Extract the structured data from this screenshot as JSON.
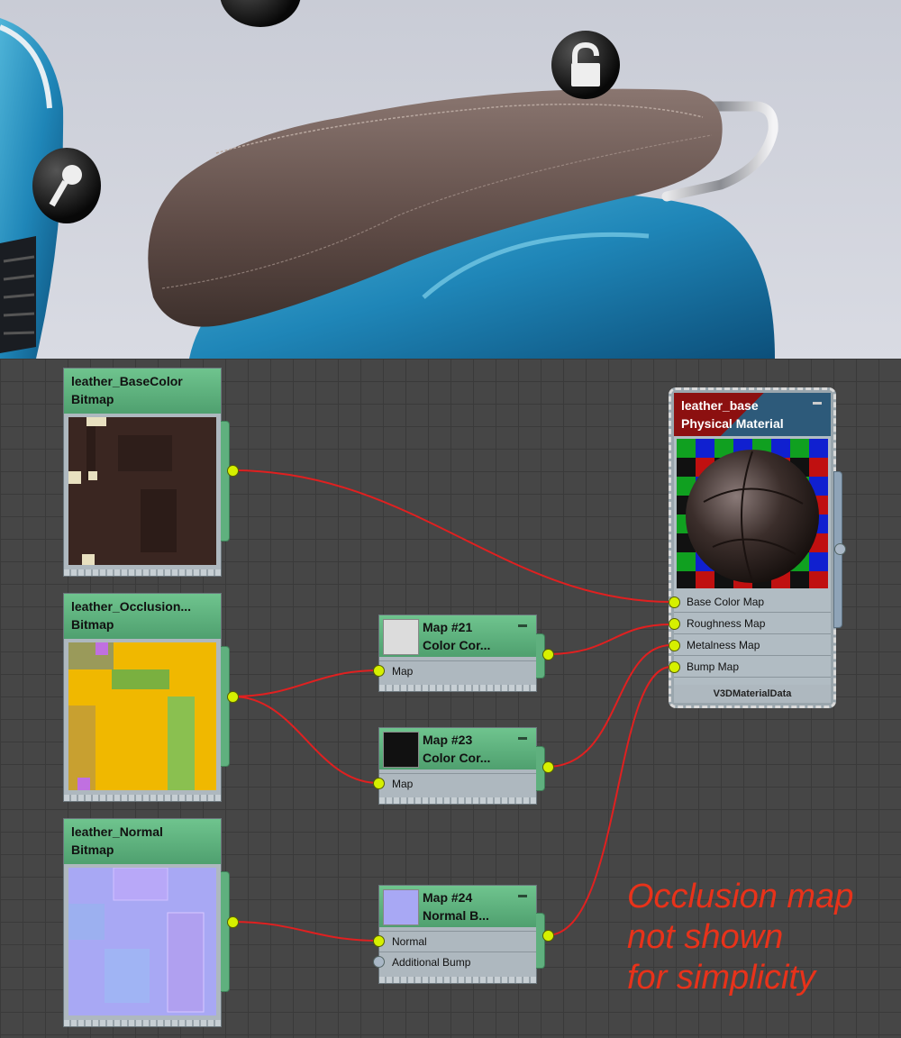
{
  "nodes": {
    "base_color": {
      "title": "leather_BaseColor",
      "type": "Bitmap"
    },
    "occlusion": {
      "title": "leather_Occlusion...",
      "type": "Bitmap"
    },
    "normal": {
      "title": "leather_Normal",
      "type": "Bitmap"
    },
    "map21": {
      "title": "Map #21",
      "subtitle": "Color Cor...",
      "socket": "Map"
    },
    "map23": {
      "title": "Map #23",
      "subtitle": "Color Cor...",
      "socket": "Map"
    },
    "map24": {
      "title": "Map #24",
      "subtitle": "Normal B...",
      "sockets": [
        "Normal",
        "Additional Bump"
      ]
    }
  },
  "material": {
    "name": "leather_base",
    "type": "Physical Material",
    "inputs": [
      "Base Color Map",
      "Roughness Map",
      "Metalness Map",
      "Bump Map"
    ],
    "footer": "V3DMaterialData"
  },
  "annotation": "Occlusion map\nnot shown\nfor simplicity",
  "icons": [
    "lock-icon",
    "key-icon"
  ],
  "colors": {
    "wire": "#e02020",
    "socket": "#d6f000",
    "node_header": "#5fb07e",
    "annotation": "#e8321a"
  }
}
